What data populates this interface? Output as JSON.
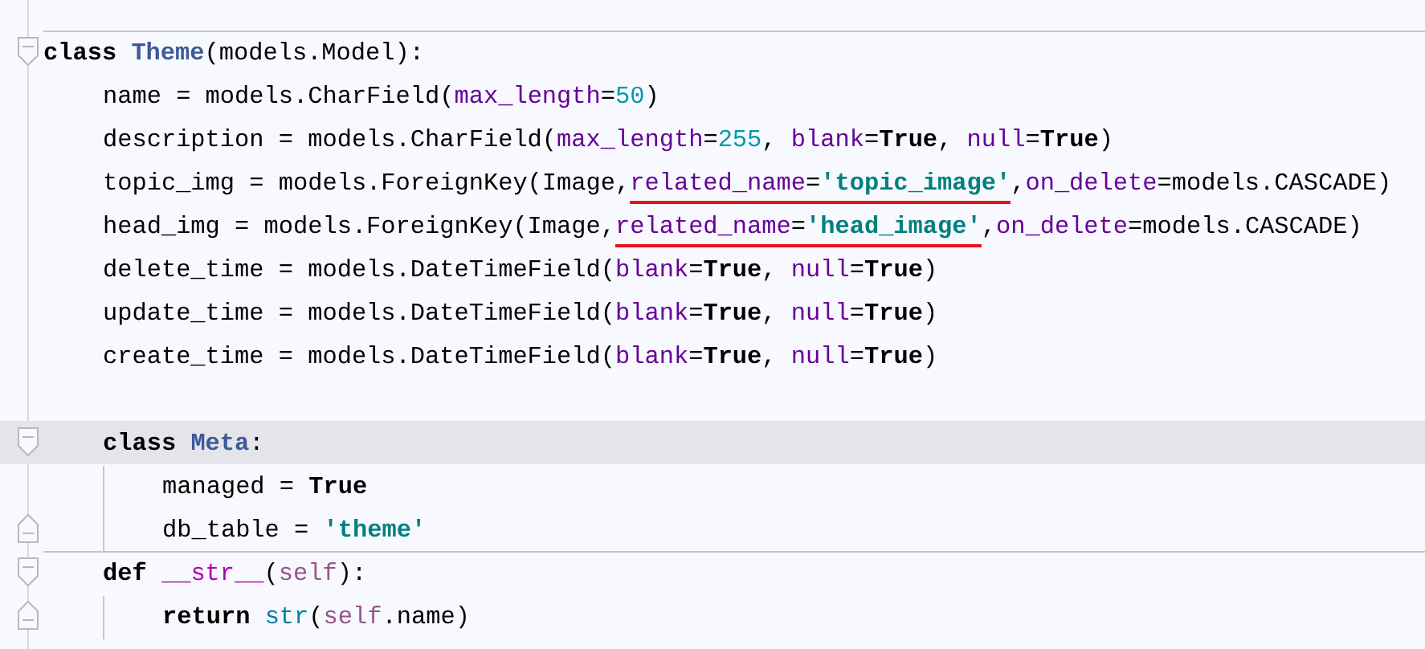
{
  "editor": {
    "lines": [
      {
        "kind": "code",
        "fold": {
          "kind": "start"
        },
        "separator": true,
        "current": false,
        "tokens": [
          {
            "t": "class ",
            "kind": "kw"
          },
          {
            "t": "Theme",
            "kind": "cls"
          },
          {
            "t": "(models.Model):",
            "kind": "plain"
          }
        ],
        "children": [
          {
            "kind": "code",
            "current": false,
            "tokens": [
              {
                "t": "name = models.CharField(",
                "kind": "plain"
              },
              {
                "t": "max_length",
                "kind": "param"
              },
              {
                "t": "=",
                "kind": "plain"
              },
              {
                "t": "50",
                "kind": "num"
              },
              {
                "t": ")",
                "kind": "plain"
              }
            ]
          },
          {
            "kind": "code",
            "current": false,
            "tokens": [
              {
                "t": "description = models.CharField(",
                "kind": "plain"
              },
              {
                "t": "max_length",
                "kind": "param"
              },
              {
                "t": "=",
                "kind": "plain"
              },
              {
                "t": "255",
                "kind": "num"
              },
              {
                "t": ", ",
                "kind": "plain"
              },
              {
                "t": "blank",
                "kind": "param"
              },
              {
                "t": "=",
                "kind": "plain"
              },
              {
                "t": "True",
                "kind": "bool"
              },
              {
                "t": ", ",
                "kind": "plain"
              },
              {
                "t": "null",
                "kind": "param"
              },
              {
                "t": "=",
                "kind": "plain"
              },
              {
                "t": "True",
                "kind": "bool"
              },
              {
                "t": ")",
                "kind": "plain"
              }
            ]
          },
          {
            "kind": "code",
            "current": false,
            "tokens": [
              {
                "t": "topic_img = models.ForeignKey(Image,",
                "kind": "plain"
              },
              {
                "t": "related_name",
                "kind": "param",
                "underlined": true
              },
              {
                "t": "=",
                "kind": "plain",
                "underlined": true
              },
              {
                "t": "'topic_image'",
                "kind": "str",
                "underlined": true
              },
              {
                "t": ",",
                "kind": "plain"
              },
              {
                "t": "on_delete",
                "kind": "param"
              },
              {
                "t": "=models.CASCADE)",
                "kind": "plain"
              }
            ]
          },
          {
            "kind": "code",
            "current": false,
            "tokens": [
              {
                "t": "head_img = models.ForeignKey(Image,",
                "kind": "plain"
              },
              {
                "t": "related_name",
                "kind": "param",
                "underlined": true
              },
              {
                "t": "=",
                "kind": "plain",
                "underlined": true
              },
              {
                "t": "'head_image'",
                "kind": "str",
                "underlined": true
              },
              {
                "t": ",",
                "kind": "plain"
              },
              {
                "t": "on_delete",
                "kind": "param"
              },
              {
                "t": "=models.CASCADE)",
                "kind": "plain"
              }
            ]
          },
          {
            "kind": "code",
            "current": false,
            "tokens": [
              {
                "t": "delete_time = models.DateTimeField(",
                "kind": "plain"
              },
              {
                "t": "blank",
                "kind": "param"
              },
              {
                "t": "=",
                "kind": "plain"
              },
              {
                "t": "True",
                "kind": "bool"
              },
              {
                "t": ", ",
                "kind": "plain"
              },
              {
                "t": "null",
                "kind": "param"
              },
              {
                "t": "=",
                "kind": "plain"
              },
              {
                "t": "True",
                "kind": "bool"
              },
              {
                "t": ")",
                "kind": "plain"
              }
            ]
          },
          {
            "kind": "code",
            "current": false,
            "tokens": [
              {
                "t": "update_time = models.DateTimeField(",
                "kind": "plain"
              },
              {
                "t": "blank",
                "kind": "param"
              },
              {
                "t": "=",
                "kind": "plain"
              },
              {
                "t": "True",
                "kind": "bool"
              },
              {
                "t": ", ",
                "kind": "plain"
              },
              {
                "t": "null",
                "kind": "param"
              },
              {
                "t": "=",
                "kind": "plain"
              },
              {
                "t": "True",
                "kind": "bool"
              },
              {
                "t": ")",
                "kind": "plain"
              }
            ]
          },
          {
            "kind": "code",
            "current": false,
            "tokens": [
              {
                "t": "create_time = models.DateTimeField(",
                "kind": "plain"
              },
              {
                "t": "blank",
                "kind": "param"
              },
              {
                "t": "=",
                "kind": "plain"
              },
              {
                "t": "True",
                "kind": "bool"
              },
              {
                "t": ", ",
                "kind": "plain"
              },
              {
                "t": "null",
                "kind": "param"
              },
              {
                "t": "=",
                "kind": "plain"
              },
              {
                "t": "True",
                "kind": "bool"
              },
              {
                "t": ")",
                "kind": "plain"
              }
            ]
          },
          {
            "kind": "blank"
          },
          {
            "kind": "code",
            "fold": {
              "kind": "start"
            },
            "current": true,
            "tokens": [
              {
                "t": "class ",
                "kind": "kw"
              },
              {
                "t": "Meta",
                "kind": "cls"
              },
              {
                "t": ":",
                "kind": "plain"
              }
            ],
            "children": [
              {
                "kind": "code",
                "current": false,
                "tokens": [
                  {
                    "t": "managed = ",
                    "kind": "plain"
                  },
                  {
                    "t": "True",
                    "kind": "bool"
                  }
                ]
              },
              {
                "kind": "code",
                "fold": {
                  "kind": "end"
                },
                "current": false,
                "tokens": [
                  {
                    "t": "db_table = ",
                    "kind": "plain"
                  },
                  {
                    "t": "'theme'",
                    "kind": "str"
                  }
                ]
              }
            ]
          },
          {
            "kind": "code",
            "fold": {
              "kind": "start"
            },
            "separator": true,
            "current": false,
            "tokens": [
              {
                "t": "def ",
                "kind": "kw"
              },
              {
                "t": "__str__",
                "kind": "magic"
              },
              {
                "t": "(",
                "kind": "plain"
              },
              {
                "t": "self",
                "kind": "self"
              },
              {
                "t": "):",
                "kind": "plain"
              }
            ],
            "children": [
              {
                "kind": "code",
                "fold": {
                  "kind": "end"
                },
                "current": false,
                "tokens": [
                  {
                    "t": "return ",
                    "kind": "kw"
                  },
                  {
                    "t": "str",
                    "kind": "builtin"
                  },
                  {
                    "t": "(",
                    "kind": "plain"
                  },
                  {
                    "t": "self",
                    "kind": "self"
                  },
                  {
                    "t": ".name)",
                    "kind": "plain"
                  }
                ]
              }
            ]
          }
        ]
      }
    ]
  }
}
